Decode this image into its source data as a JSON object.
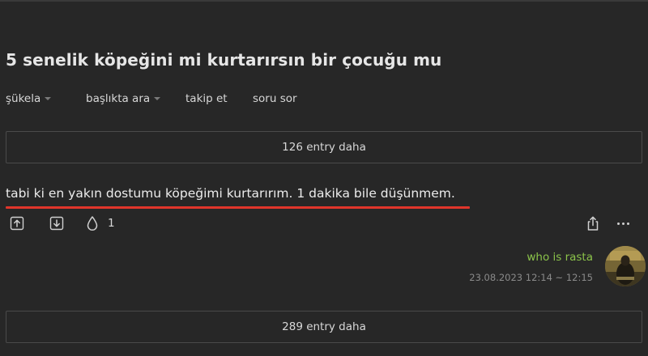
{
  "topic": {
    "title": "5 senelik köpeğini mi kurtarırsın bir çocuğu mu"
  },
  "subnav": {
    "sort_label": "şükela",
    "search_label": "başlıkta ara",
    "follow_label": "takip et",
    "ask_label": "soru sor"
  },
  "more_above": {
    "label": "126 entry daha"
  },
  "entry": {
    "text": "tabi ki en yakın dostumu köpeğimi kurtarırım. 1 dakika bile düşünmem.",
    "favorite_count": "1",
    "author": "who is rasta",
    "date": "23.08.2023 12:14 ~ 12:15"
  },
  "more_below": {
    "label": "289 entry daha"
  },
  "icons": {
    "upvote": "upvote-icon",
    "downvote": "downvote-icon",
    "favorite": "drop-icon",
    "share": "share-icon",
    "more": "more-icon"
  },
  "colors": {
    "background": "#272727",
    "author": "#8bc34a",
    "highlight_underline": "#e0352b"
  }
}
